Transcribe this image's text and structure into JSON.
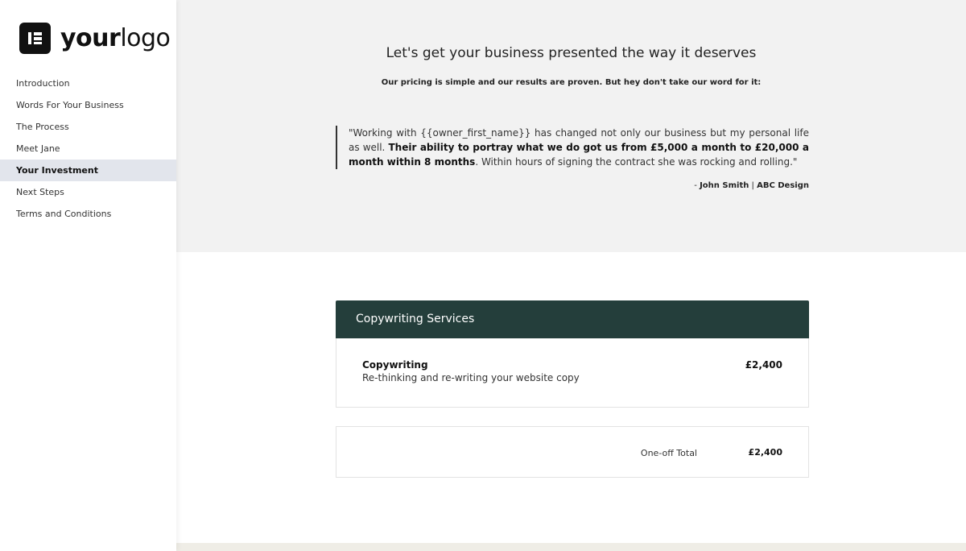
{
  "sidebar": {
    "logo": {
      "bold": "your",
      "light": "logo"
    },
    "items": [
      {
        "label": "Introduction",
        "active": false
      },
      {
        "label": "Words For Your Business",
        "active": false
      },
      {
        "label": "The Process",
        "active": false
      },
      {
        "label": "Meet Jane",
        "active": false
      },
      {
        "label": "Your Investment",
        "active": true
      },
      {
        "label": "Next Steps",
        "active": false
      },
      {
        "label": "Terms and Conditions",
        "active": false
      }
    ]
  },
  "hero": {
    "title": "Let's get your business presented the way it deserves",
    "subtitle": "Our pricing is simple and our results are proven. But hey don't take our word for it:",
    "quote": {
      "part1": "\"Working with {{owner_first_name}} has changed not only our business but my personal life as well. ",
      "bold": "Their ability to portray what we do got us from £5,000 a month to £20,000 a month within 8 months",
      "part2": ". Within hours of signing the contract she was rocking and rolling.\"",
      "author_prefix": "- ",
      "author_name": "John Smith",
      "author_sep": " | ",
      "author_company": "ABC Design"
    }
  },
  "services": {
    "header": "Copywriting Services",
    "items": [
      {
        "name": "Copywriting",
        "description": "Re-thinking and re-writing your website copy",
        "price": "£2,400"
      }
    ],
    "total_label": "One-off Total",
    "total_value": "£2,400"
  },
  "colors": {
    "header_bg": "#243e3b",
    "active_nav": "#e2e5ec",
    "hero_bg": "#f2f2f2"
  }
}
